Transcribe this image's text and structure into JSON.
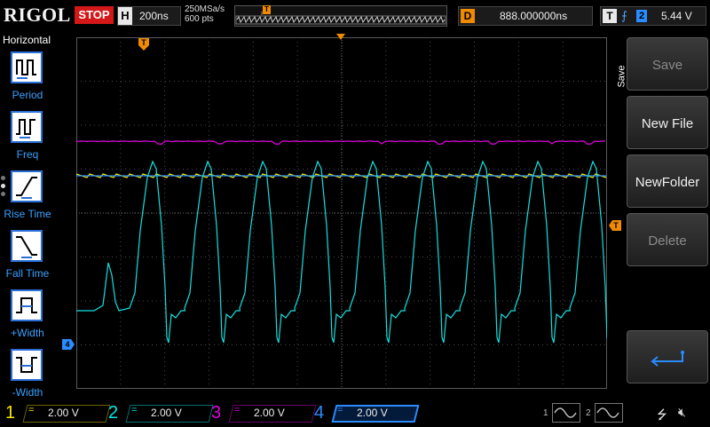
{
  "brand": "RIGOL",
  "run_state": "STOP",
  "horizontal": {
    "letter": "H",
    "timebase": "200ns",
    "sample_rate": "250MSa/s",
    "memory_depth": "600  pts"
  },
  "delay": {
    "letter": "D",
    "value": "888.000000ns"
  },
  "trigger": {
    "letter": "T",
    "source": "2",
    "level": "5.44 V",
    "marker": "T"
  },
  "left_menu": {
    "title": "Horizontal",
    "items": [
      {
        "label": "Period"
      },
      {
        "label": "Freq"
      },
      {
        "label": "Rise Time"
      },
      {
        "label": "Fall Time"
      },
      {
        "label": "+Width"
      },
      {
        "label": "-Width"
      }
    ]
  },
  "right_menu": {
    "title": "Save",
    "buttons": [
      {
        "label": "Save"
      },
      {
        "label": "New File"
      },
      {
        "label": "NewFolder"
      },
      {
        "label": "Delete"
      }
    ],
    "enter_icon": "return-arrow-icon"
  },
  "channels": [
    {
      "num": "1",
      "coupling": "=",
      "scale": "2.00 V",
      "color": "#f5e800"
    },
    {
      "num": "2",
      "coupling": "=",
      "scale": "2.00 V",
      "color": "#00e8e8"
    },
    {
      "num": "3",
      "coupling": "=",
      "scale": "2.00 V",
      "color": "#e000e0"
    },
    {
      "num": "4",
      "coupling": "=",
      "scale": "2.00 V",
      "color": "#2a8cff"
    }
  ],
  "generators": [
    {
      "num": "1",
      "icon": "sine-wave-icon"
    },
    {
      "num": "2",
      "icon": "sine-wave-icon"
    }
  ],
  "status_icons": [
    "usb-icon",
    "speaker-muted-icon"
  ],
  "ch4_marker": "4",
  "trigger_level_marker": "T"
}
